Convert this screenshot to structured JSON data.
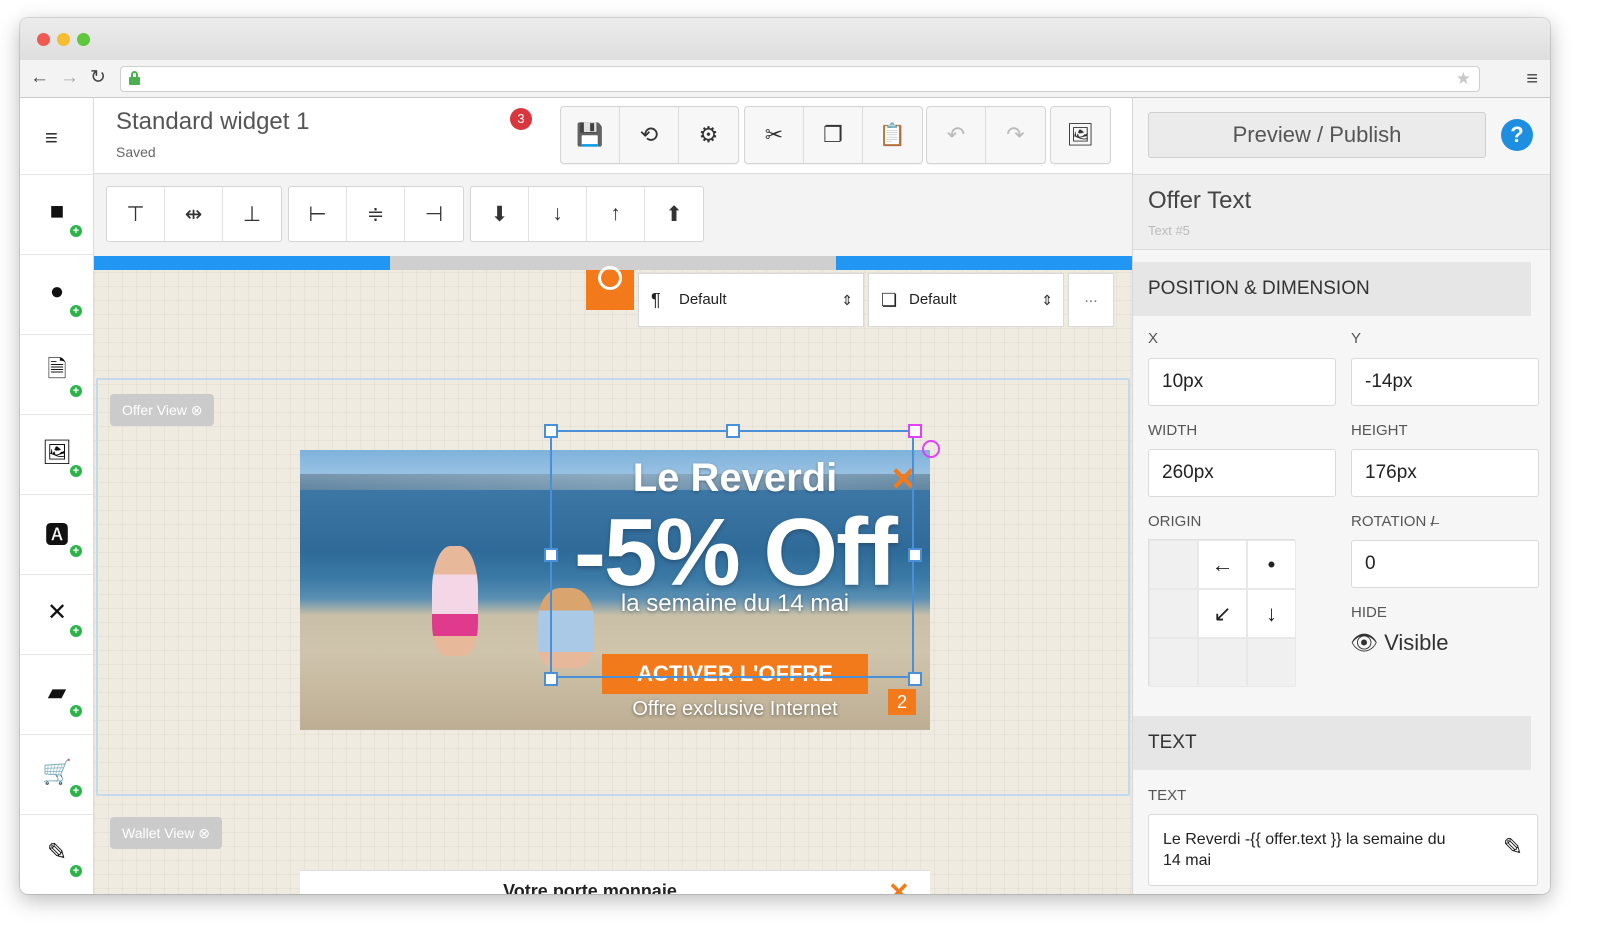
{
  "browser": {
    "nav_back": "←",
    "nav_forward": "→",
    "nav_reload": "↻"
  },
  "app": {
    "widget_title": "Standard widget 1",
    "widget_status": "Saved",
    "notification_count": "3"
  },
  "toolbar": {
    "buttons": [
      {
        "icon": "save-icon",
        "glyph": "💾"
      },
      {
        "icon": "history-icon",
        "glyph": "⟲"
      },
      {
        "icon": "gear-icon",
        "glyph": "⚙"
      },
      {
        "icon": "cut-icon",
        "glyph": "✂"
      },
      {
        "icon": "copy-icon",
        "glyph": "❐"
      },
      {
        "icon": "paste-icon",
        "glyph": "📋"
      },
      {
        "icon": "undo-icon",
        "glyph": "↶"
      },
      {
        "icon": "redo-icon",
        "glyph": "↷"
      },
      {
        "icon": "image-export-icon",
        "glyph": "🖼"
      }
    ]
  },
  "sidebar": {
    "tools": [
      {
        "name": "rectangle-tool",
        "glyph": "■"
      },
      {
        "name": "circle-tool",
        "glyph": "●"
      },
      {
        "name": "document-tool",
        "glyph": "🗎"
      },
      {
        "name": "image-tool",
        "glyph": "🖼"
      },
      {
        "name": "text-tool",
        "glyph": "🅰"
      },
      {
        "name": "close-tool",
        "glyph": "✕"
      },
      {
        "name": "wallet-tool",
        "glyph": "▰"
      },
      {
        "name": "cart-tool",
        "glyph": "🛒"
      },
      {
        "name": "edit-tool",
        "glyph": "✎"
      }
    ]
  },
  "align_toolbar": {
    "buttons": [
      {
        "icon": "align-top-icon",
        "glyph": "⊤"
      },
      {
        "icon": "align-middle-icon",
        "glyph": "⇹"
      },
      {
        "icon": "align-bottom-icon",
        "glyph": "⊥"
      },
      {
        "icon": "align-left-icon",
        "glyph": "⊢"
      },
      {
        "icon": "align-center-icon",
        "glyph": "≑"
      },
      {
        "icon": "align-right-icon",
        "glyph": "⊣"
      },
      {
        "icon": "send-to-back-icon",
        "glyph": "⬇"
      },
      {
        "icon": "send-backward-icon",
        "glyph": "↓"
      },
      {
        "icon": "bring-forward-icon",
        "glyph": "↑"
      },
      {
        "icon": "bring-to-front-icon",
        "glyph": "⬆"
      }
    ]
  },
  "canvas": {
    "style_select_1": "Default",
    "style_select_2": "Default",
    "more_label": "...",
    "offer_view_label": "Offer View ⊗",
    "wallet_view_label": "Wallet View ⊗",
    "wallet_title": "Votre porte monnaie",
    "wallet_close": "✕"
  },
  "banner": {
    "brand": "Le Reverdi",
    "discount": "-5% Off",
    "subtitle": "la semaine du 14 mai",
    "cta": "ACTIVER L'OFFRE",
    "exclusive": "Offre exclusive Internet",
    "close": "✕",
    "counter": "2"
  },
  "panel": {
    "publish_label": "Preview / Publish",
    "help_label": "?",
    "title": "Offer Text",
    "subtitle": "Text #5",
    "section_position": "POSITION & DIMENSION",
    "x_label": "X",
    "x_value": "10px",
    "y_label": "Y",
    "y_value": "-14px",
    "width_label": "WIDTH",
    "width_value": "260px",
    "height_label": "HEIGHT",
    "height_value": "176px",
    "origin_label": "ORIGIN",
    "origin_cells": [
      "",
      "←",
      "•",
      "",
      "↙",
      "↓",
      "",
      "",
      ""
    ],
    "rotation_label": "ROTATION",
    "rotation_value": "0",
    "hide_label": "HIDE",
    "visibility_value": "Visible",
    "section_text": "TEXT",
    "text_label": "TEXT",
    "text_value": "Le Reverdi -{{ offer.text }} la semaine du 14 mai"
  },
  "colors": {
    "accent_blue": "#2196f3",
    "brand_orange": "#f27a1a",
    "badge_red": "#d9363e",
    "help_blue": "#1e8fe0",
    "add_green": "#2db34a"
  }
}
